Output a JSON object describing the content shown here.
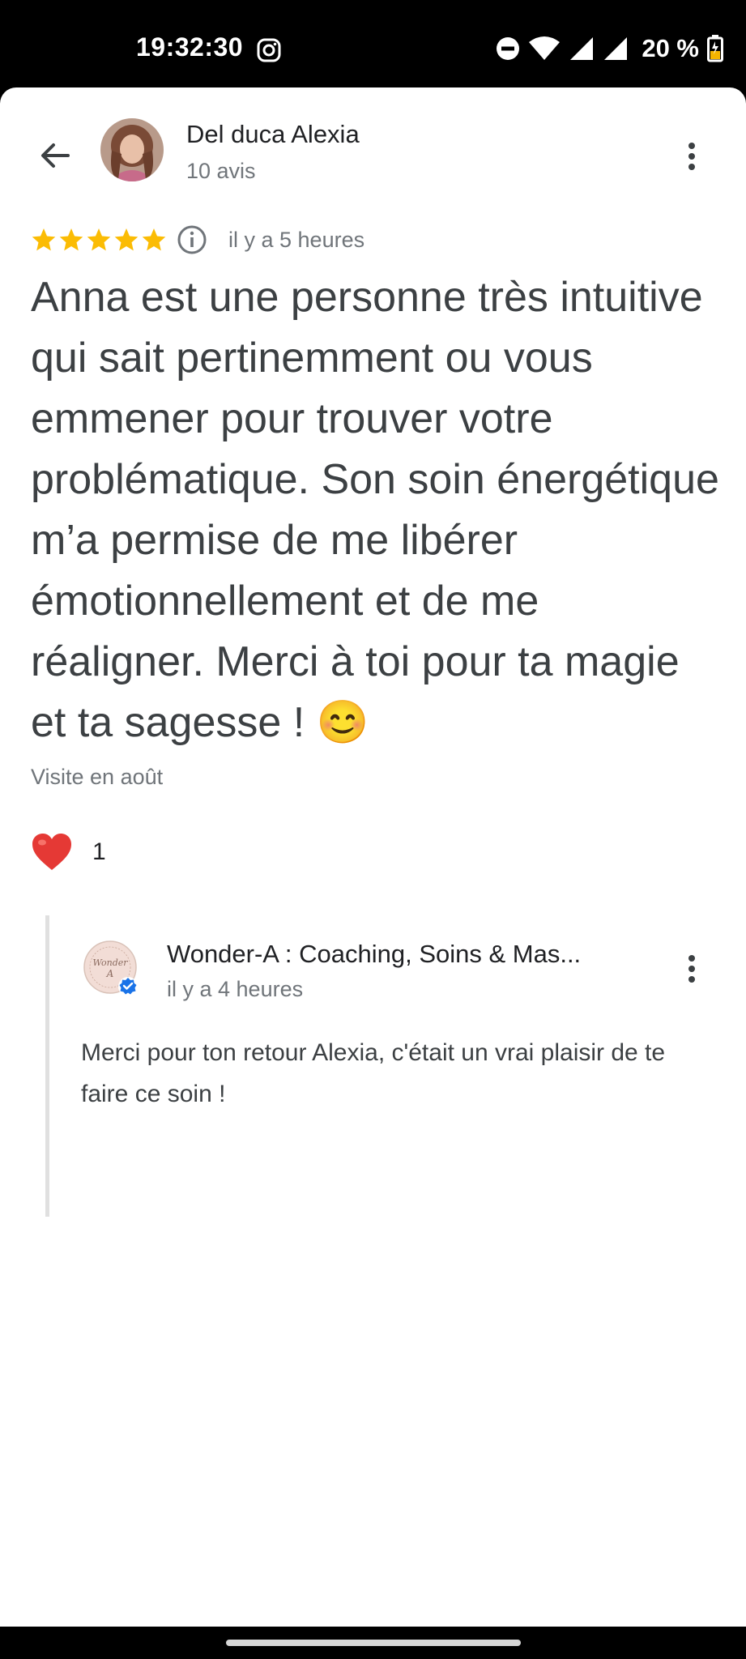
{
  "status_bar": {
    "time": "19:32:30",
    "battery_percent": "20 %",
    "icons": [
      "instagram-icon",
      "do-not-disturb-icon",
      "wifi-icon",
      "signal-icon",
      "signal-icon",
      "battery-charging-icon"
    ]
  },
  "header": {
    "author_name": "Del duca Alexia",
    "review_count": "10 avis"
  },
  "review": {
    "rating": 5,
    "max_rating": 5,
    "time_ago": "il y a 5 heures",
    "text": "Anna est une personne très intuitive qui sait pertinemment ou vous emmener pour trouver votre problématique. Son soin énergétique m’a permise de me libérer émotionnellement et de me réaligner. Merci à toi pour ta magie et ta sagesse ! 😊",
    "visit": "Visite en août",
    "like_count": "1"
  },
  "owner_reply": {
    "name": "Wonder-A : Coaching, Soins & Mas...",
    "time_ago": "il y a 4 heures",
    "text": "Merci pour ton retour Alexia, c'était un vrai plaisir de te faire ce soin !",
    "logo_text": "Wonder A"
  },
  "colors": {
    "star": "#fbbc04",
    "heart": "#e53935",
    "verified": "#1a73e8",
    "text_secondary": "#70757a"
  }
}
